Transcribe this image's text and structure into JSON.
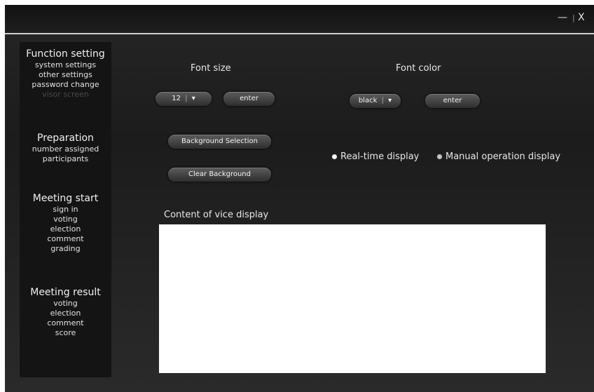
{
  "window": {
    "minimize_icon": "—",
    "sep": "|",
    "close_icon": "X"
  },
  "sidebar": {
    "function_setting": {
      "title": "Function setting",
      "items": [
        "system settings",
        "other settings",
        "password change",
        "visor screen"
      ]
    },
    "preparation": {
      "title": "Preparation",
      "items": [
        "number assigned",
        "participants"
      ]
    },
    "meeting_start": {
      "title": "Meeting start",
      "items": [
        "sign in",
        "voting",
        "election",
        "comment",
        "grading"
      ]
    },
    "meeting_result": {
      "title": "Meeting result",
      "items": [
        "voting",
        "election",
        "comment",
        "score"
      ]
    }
  },
  "font_size": {
    "label": "Font size",
    "value": "12",
    "enter_label": "enter"
  },
  "font_color": {
    "label": "Font color",
    "value": "black",
    "enter_label": "enter"
  },
  "dropdown_arrow": "▾",
  "background": {
    "select_label": "Background Selection",
    "clear_label": "Clear Background"
  },
  "display_mode": {
    "realtime_label": "Real-time display",
    "manual_label": "Manual operation display",
    "selected": "realtime"
  },
  "content": {
    "label": "Content of vice display",
    "text": ""
  }
}
